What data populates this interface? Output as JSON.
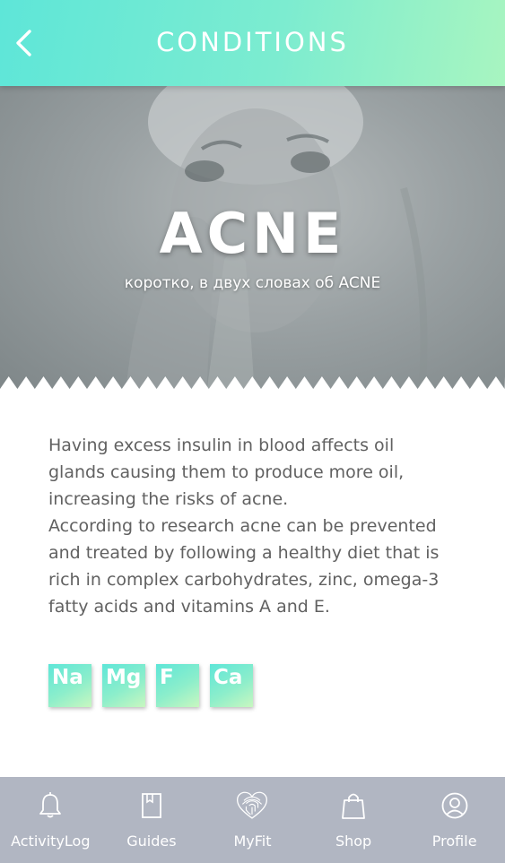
{
  "header": {
    "title": "CONDITIONS",
    "back_icon": "chevron-left-icon"
  },
  "hero": {
    "title": "ACNE",
    "subtitle": "коротко, в двух словах об ACNE"
  },
  "content": {
    "paragraph1": "Having excess insulin in blood affects oil glands causing them to produce more oil, increasing the risks of acne.",
    "paragraph2": "According to research acne can be prevented and treated by following a healthy diet that is rich in complex carbohydrates, zinc, omega-3 fatty acids and vitamins A and E."
  },
  "elements": [
    "Na",
    "Mg",
    "F",
    "Ca"
  ],
  "nav": {
    "items": [
      {
        "label": "ActivityLog",
        "icon": "bell-icon"
      },
      {
        "label": "Guides",
        "icon": "book-icon"
      },
      {
        "label": "MyFit",
        "icon": "fingerprint-heart-icon"
      },
      {
        "label": "Shop",
        "icon": "shopping-bag-icon"
      },
      {
        "label": "Profile",
        "icon": "user-circle-icon"
      }
    ]
  },
  "colors": {
    "header_gradient_start": "#5ee6d8",
    "header_gradient_end": "#a8f5c0",
    "nav_background": "#b1b6c2",
    "body_text": "#616161"
  }
}
